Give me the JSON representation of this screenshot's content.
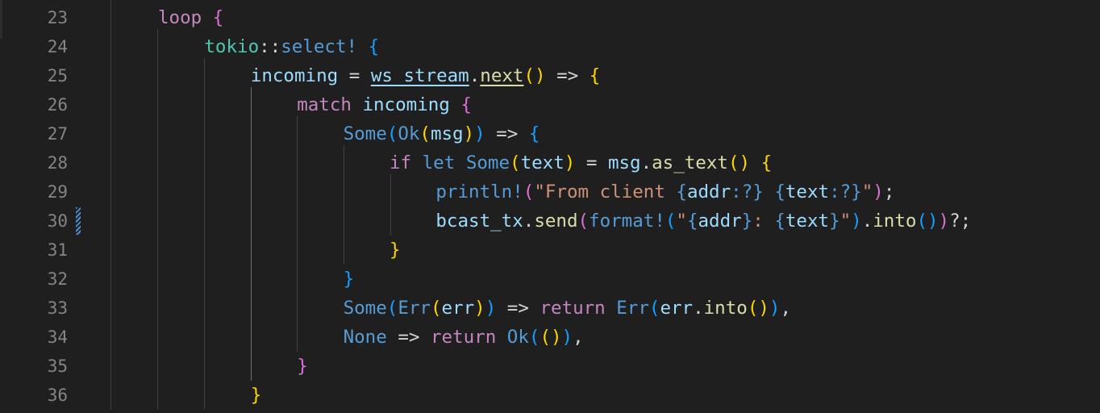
{
  "editor": {
    "language": "rust",
    "colors": {
      "background": "#1f1f1f",
      "line_number": "#858585",
      "control_keyword": "#c586c0",
      "keyword": "#569cd6",
      "variable": "#9cdcfe",
      "function": "#dcdcaa",
      "namespace": "#4ec9b0",
      "string": "#ce9178",
      "bracket_level1": "#ffd700",
      "bracket_level2": "#da70d6",
      "bracket_level3": "#179fff"
    },
    "modified_line": 30,
    "lines": [
      {
        "number": "23",
        "tokens": [
          [
            "ctl",
            "loop"
          ],
          [
            "op",
            " "
          ],
          [
            "b2",
            "{"
          ]
        ]
      },
      {
        "number": "24",
        "tokens": [
          [
            "ns",
            "tokio"
          ],
          [
            "op",
            "::"
          ],
          [
            "kw",
            "select!"
          ],
          [
            "op",
            " "
          ],
          [
            "b3",
            "{"
          ]
        ]
      },
      {
        "number": "25",
        "tokens": [
          [
            "var",
            "incoming"
          ],
          [
            "op",
            " = "
          ],
          [
            "var",
            "ws_stream",
            "ul"
          ],
          [
            "op",
            "."
          ],
          [
            "fn",
            "next",
            "ul"
          ],
          [
            "b1",
            "()"
          ],
          [
            "op",
            " => "
          ],
          [
            "b1",
            "{"
          ]
        ]
      },
      {
        "number": "26",
        "tokens": [
          [
            "ctl",
            "match"
          ],
          [
            "op",
            " "
          ],
          [
            "var",
            "incoming"
          ],
          [
            "op",
            " "
          ],
          [
            "b2",
            "{"
          ]
        ]
      },
      {
        "number": "27",
        "tokens": [
          [
            "kw",
            "Some"
          ],
          [
            "b3",
            "("
          ],
          [
            "kw",
            "Ok"
          ],
          [
            "b1",
            "("
          ],
          [
            "var",
            "msg"
          ],
          [
            "b1",
            ")"
          ],
          [
            "b3",
            ")"
          ],
          [
            "op",
            " => "
          ],
          [
            "b3",
            "{"
          ]
        ]
      },
      {
        "number": "28",
        "tokens": [
          [
            "ctl",
            "if"
          ],
          [
            "op",
            " "
          ],
          [
            "kw",
            "let"
          ],
          [
            "op",
            " "
          ],
          [
            "kw",
            "Some"
          ],
          [
            "b1",
            "("
          ],
          [
            "var",
            "text"
          ],
          [
            "b1",
            ")"
          ],
          [
            "op",
            " = "
          ],
          [
            "var",
            "msg"
          ],
          [
            "op",
            "."
          ],
          [
            "fn",
            "as_text"
          ],
          [
            "b1",
            "()"
          ],
          [
            "op",
            " "
          ],
          [
            "b1",
            "{"
          ]
        ]
      },
      {
        "number": "29",
        "tokens": [
          [
            "kw",
            "println!"
          ],
          [
            "b2",
            "("
          ],
          [
            "str",
            "\"From client "
          ],
          [
            "kw",
            "{"
          ],
          [
            "var",
            "addr"
          ],
          [
            "kw",
            ":?}"
          ],
          [
            "str",
            " "
          ],
          [
            "kw",
            "{"
          ],
          [
            "var",
            "text"
          ],
          [
            "kw",
            ":?}"
          ],
          [
            "str",
            "\""
          ],
          [
            "b2",
            ")"
          ],
          [
            "op",
            ";"
          ]
        ]
      },
      {
        "number": "30",
        "tokens": [
          [
            "var",
            "bcast_tx"
          ],
          [
            "op",
            "."
          ],
          [
            "fn",
            "send"
          ],
          [
            "b2",
            "("
          ],
          [
            "kw",
            "format!"
          ],
          [
            "b3",
            "("
          ],
          [
            "str",
            "\""
          ],
          [
            "kw",
            "{"
          ],
          [
            "var",
            "addr"
          ],
          [
            "kw",
            "}"
          ],
          [
            "str",
            ": "
          ],
          [
            "kw",
            "{"
          ],
          [
            "var",
            "text"
          ],
          [
            "kw",
            "}"
          ],
          [
            "str",
            "\""
          ],
          [
            "b3",
            ")"
          ],
          [
            "op",
            "."
          ],
          [
            "fn",
            "into"
          ],
          [
            "b3",
            "()"
          ],
          [
            "b2",
            ")"
          ],
          [
            "op",
            "?;"
          ]
        ]
      },
      {
        "number": "31",
        "tokens": [
          [
            "b1",
            "}"
          ]
        ]
      },
      {
        "number": "32",
        "tokens": [
          [
            "b3",
            "}"
          ]
        ]
      },
      {
        "number": "33",
        "tokens": [
          [
            "kw",
            "Some"
          ],
          [
            "b3",
            "("
          ],
          [
            "kw",
            "Err"
          ],
          [
            "b1",
            "("
          ],
          [
            "var",
            "err"
          ],
          [
            "b1",
            ")"
          ],
          [
            "b3",
            ")"
          ],
          [
            "op",
            " => "
          ],
          [
            "ctl",
            "return"
          ],
          [
            "op",
            " "
          ],
          [
            "kw",
            "Err"
          ],
          [
            "b3",
            "("
          ],
          [
            "var",
            "err"
          ],
          [
            "op",
            "."
          ],
          [
            "fn",
            "into"
          ],
          [
            "b1",
            "()"
          ],
          [
            "b3",
            ")"
          ],
          [
            "op",
            ","
          ]
        ]
      },
      {
        "number": "34",
        "tokens": [
          [
            "kw",
            "None"
          ],
          [
            "op",
            " => "
          ],
          [
            "ctl",
            "return"
          ],
          [
            "op",
            " "
          ],
          [
            "kw",
            "Ok"
          ],
          [
            "b3",
            "("
          ],
          [
            "b1",
            "()"
          ],
          [
            "b3",
            ")"
          ],
          [
            "op",
            ","
          ]
        ]
      },
      {
        "number": "35",
        "tokens": [
          [
            "b2",
            "}"
          ]
        ]
      },
      {
        "number": "36",
        "tokens": [
          [
            "b1",
            "}"
          ]
        ]
      }
    ]
  }
}
